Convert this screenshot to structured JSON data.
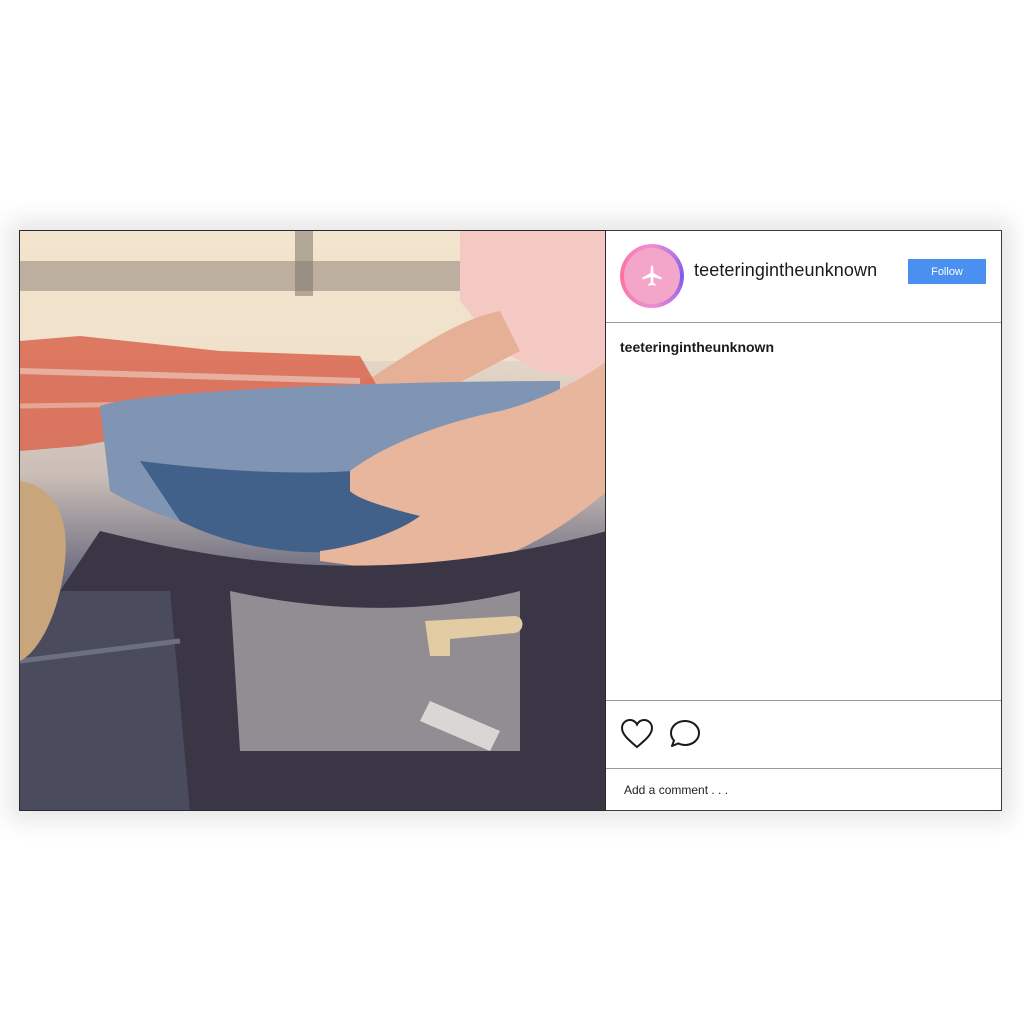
{
  "post": {
    "username": "teeteringintheunknown",
    "follow_label": "Follow",
    "caption_username": "teeteringintheunknown",
    "comment_placeholder": "Add a comment . . .",
    "avatar_icon": "airplane-icon",
    "like_icon": "heart-icon",
    "comment_icon": "comment-bubble-icon",
    "photo_subject": "packing-suitcase-photo"
  },
  "colors": {
    "follow_button": "#4a90f0",
    "avatar_bg": "#f4a6c9",
    "avatar_ring": "#c86de0"
  }
}
